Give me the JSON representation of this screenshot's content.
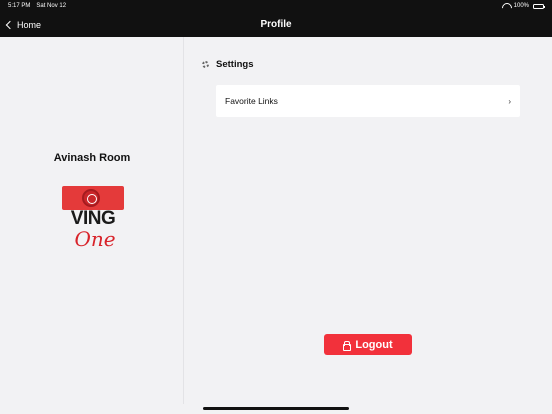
{
  "status_bar": {
    "time": "5:17 PM",
    "date": "Sat Nov 12",
    "battery_text": "100%",
    "icons": [
      "wifi-icon",
      "battery-icon"
    ]
  },
  "nav": {
    "back_label": "Home",
    "back_icon": "chevron-left-icon",
    "title": "Profile"
  },
  "profile": {
    "user_name": "Avinash Room",
    "logo": {
      "line1": "VING",
      "line2": "One",
      "brand_color": "#e43a3a"
    }
  },
  "settings": {
    "header_icon": "gear-icon",
    "header_label": "Settings",
    "items": [
      {
        "label": "Favorite Links",
        "icon": "chevron-right-icon"
      }
    ]
  },
  "logout": {
    "label": "Logout",
    "icon": "lock-icon",
    "color": "#f2313b"
  }
}
